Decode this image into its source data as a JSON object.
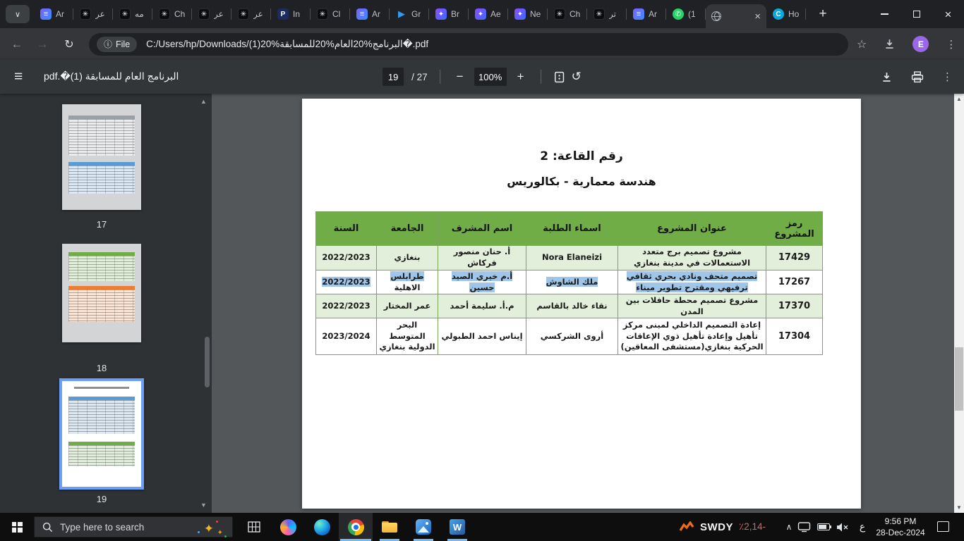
{
  "browser": {
    "tab_search_icon": "∨",
    "new_tab_label": "+",
    "window_close_icon": "×",
    "favicon_glyphs": {
      "doc": "≡",
      "gpt": "✳",
      "pbadge": "P",
      "play": "▶",
      "badge": "✦",
      "whatsapp": "✆",
      "circlec": "C",
      "globe": ""
    },
    "tabs": [
      {
        "icon": "doc",
        "label": "Ar"
      },
      {
        "icon": "gpt",
        "label": "عر"
      },
      {
        "icon": "gpt",
        "label": "مه"
      },
      {
        "icon": "gpt",
        "label": "Ch"
      },
      {
        "icon": "gpt",
        "label": "عر"
      },
      {
        "icon": "gpt",
        "label": "عر"
      },
      {
        "icon": "pbadge",
        "label": "In"
      },
      {
        "icon": "gpt",
        "label": "Cl"
      },
      {
        "icon": "doc",
        "label": "Ar"
      },
      {
        "icon": "play",
        "label": "Gr"
      },
      {
        "icon": "badge",
        "label": "Br"
      },
      {
        "icon": "badge",
        "label": "Ae"
      },
      {
        "icon": "badge",
        "label": "Ne"
      },
      {
        "icon": "gpt",
        "label": "Ch"
      },
      {
        "icon": "gpt",
        "label": "تر"
      },
      {
        "icon": "doc",
        "label": "Ar"
      },
      {
        "icon": "whatsapp",
        "label": "(1"
      },
      {
        "icon": "globe",
        "label": "",
        "active": true,
        "close": true
      },
      {
        "icon": "circlec",
        "label": "Ho"
      }
    ],
    "address": {
      "back_icon": "←",
      "forward_icon": "→",
      "reload_icon": "↻",
      "info_icon": "ⓘ",
      "file_chip_label": "File",
      "url": "C:/Users/hp/Downloads/البرنامج%20العام%20للمسابقة%20(1)�.pdf",
      "bookmark_icon": "☆",
      "avatar_letter": "E",
      "menu_icon": "⋮"
    }
  },
  "pdf_toolbar": {
    "menu_icon": "≡",
    "title": "البرنامج العام للمسابقة (1)�.pdf",
    "page_current": "19",
    "page_total_label": "/ 27",
    "zoom_out_icon": "−",
    "zoom_level": "100%",
    "zoom_in_icon": "+",
    "rotate_icon": "↺",
    "kebab_icon": "⋮"
  },
  "sidebar": {
    "scroll_up_icon": "▲",
    "scroll_down_icon": "▼",
    "thumbnails": [
      {
        "page_label": "17",
        "active": false,
        "tables": [
          "gray",
          "blue"
        ]
      },
      {
        "page_label": "18",
        "active": false,
        "tables": [
          "green",
          "orange"
        ]
      },
      {
        "page_label": "19",
        "active": true,
        "tables": [
          "blue",
          "green"
        ]
      }
    ]
  },
  "scrollbar": {
    "up_icon": "▲",
    "down_icon": "▼"
  },
  "document": {
    "room_heading": "رقم القاعة: 2",
    "program_heading": "هندسة معمارية  - بكالوريس",
    "table": {
      "headers": [
        "رمز المشروع",
        "عنوان المشروع",
        "اسماء الطلبة",
        "اسم المشرف",
        "الجامعة",
        "السنة"
      ],
      "rows": [
        {
          "shade": true,
          "cells": [
            [
              {
                "t": "17429"
              }
            ],
            [
              {
                "t": "مشروع تصميم برج متعدد الاستعمالات في مدينة بنغازي"
              }
            ],
            [
              {
                "t": "Nora Elaneizi"
              }
            ],
            [
              {
                "t": "أ. حنان منصور فركاش"
              }
            ],
            [
              {
                "t": "بنغازي"
              }
            ],
            [
              {
                "t": "2022/2023"
              }
            ]
          ]
        },
        {
          "shade": false,
          "cells": [
            [
              {
                "t": "17267"
              }
            ],
            [
              {
                "t": "تصميم متحف ونادي بحري ثقافي ترفيهي ومقترح تطوير ميناء",
                "hl": true
              }
            ],
            [
              {
                "t": "ملك الشاوش",
                "hl": true
              }
            ],
            [
              {
                "t": "أ.م خيري الصيد حسين",
                "hl": true
              }
            ],
            [
              {
                "t": "طرابلس",
                "hl": true
              },
              {
                "t": "الاهلية",
                "br": true
              }
            ],
            [
              {
                "t": "2022/2023",
                "hl": true
              }
            ]
          ]
        },
        {
          "shade": true,
          "cells": [
            [
              {
                "t": "17370"
              }
            ],
            [
              {
                "t": "مشروع تصميم محطة حافلات بين المدن"
              }
            ],
            [
              {
                "t": "نقاء خالد بالقاسم"
              }
            ],
            [
              {
                "t": "م.أ. سليمة أحمد"
              }
            ],
            [
              {
                "t": "عمر المختار"
              }
            ],
            [
              {
                "t": "2022/2023"
              }
            ]
          ]
        },
        {
          "shade": false,
          "cells": [
            [
              {
                "t": "17304"
              }
            ],
            [
              {
                "t": "إعادة التصميم الداخلي لمبنى مركز تأهيل وإعادة تأهيل ذوي الإعاقات الحركية بنغازي(مستشفى المعاقين)"
              }
            ],
            [
              {
                "t": "أروى الشركسي"
              }
            ],
            [
              {
                "t": "إيناس احمد الطبولي"
              }
            ],
            [
              {
                "t": "البحر المتوسط الدولية بنغازي"
              }
            ],
            [
              {
                "t": "2023/2024"
              }
            ]
          ]
        }
      ]
    }
  },
  "taskbar": {
    "search_placeholder": "Type here to search",
    "stock_symbol": "SWDY",
    "stock_change": "٪2,14-",
    "chevron_icon": "∧",
    "language_indicator": "ع",
    "time": "9:56 PM",
    "date": "28-Dec-2024"
  },
  "colors": {
    "table_header_green": "#70AD47",
    "table_band_green": "#E2EFDA",
    "selection_blue": "#9FC5E8",
    "active_thumb_border": "#6D9EF7",
    "taskbar_indicator": "#76B9ED"
  }
}
